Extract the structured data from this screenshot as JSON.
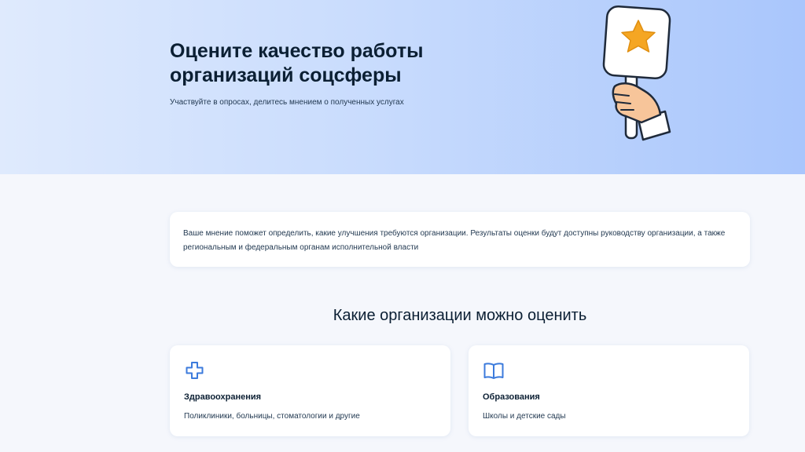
{
  "hero": {
    "title": "Оцените качество работы организаций соцсферы",
    "subtitle": "Участвуйте в опросах, делитесь мнением о полученных услугах",
    "illustration_icon": "hand-holding-star-sign-icon"
  },
  "info": {
    "text": "Ваше мнение поможет определить, какие улучшения требуются организации. Результаты оценки будут доступны руководству организации, а также региональным и федеральным органам исполнительной власти"
  },
  "section": {
    "title": "Какие организации можно оценить"
  },
  "organizations": [
    {
      "icon": "medical-cross-icon",
      "name": "Здравоохранения",
      "description": "Поликлиники, больницы, стоматологии и другие"
    },
    {
      "icon": "open-book-icon",
      "name": "Образования",
      "description": "Школы и детские сады"
    }
  ],
  "colors": {
    "accent": "#3c7bdc",
    "star": "#f5a623",
    "text": "#0b1f33"
  }
}
